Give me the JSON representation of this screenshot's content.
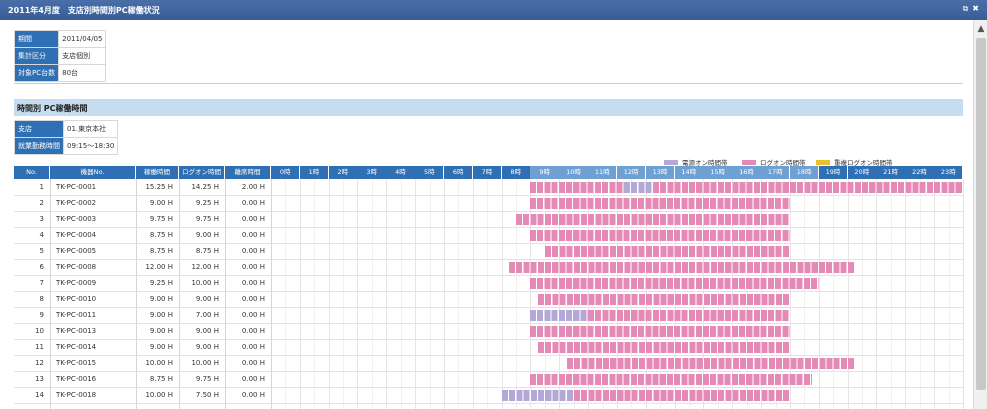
{
  "window": {
    "title": "2011年4月度　支店別時間別PC稼働状況",
    "controls": [
      "restore-icon",
      "close-icon"
    ]
  },
  "info": [
    {
      "label": "期間",
      "value": "2011/04/05"
    },
    {
      "label": "集計区分",
      "value": "支店個別"
    },
    {
      "label": "対象PC台数",
      "value": "80台"
    }
  ],
  "section_title": "時間別 PC稼働時間",
  "branch_info": [
    {
      "label": "支店",
      "value": "01.東京本社"
    },
    {
      "label": "就業勤務時間",
      "value": "09:15～18:30"
    }
  ],
  "legend": [
    {
      "label": "電源オン時間帯",
      "color": "#b3a8d6"
    },
    {
      "label": "ログオン時間帯",
      "color": "#e58ab7"
    },
    {
      "label": "重複ログオン時間帯",
      "color": "#e5c12a"
    }
  ],
  "columns": [
    "No.",
    "機器No.",
    "稼働時間",
    "ログオン時間",
    "離席時間"
  ],
  "hours": [
    "0時",
    "1時",
    "2時",
    "3時",
    "4時",
    "5時",
    "6時",
    "7時",
    "8時",
    "9時",
    "10時",
    "11時",
    "12時",
    "13時",
    "14時",
    "15時",
    "16時",
    "17時",
    "18時",
    "19時",
    "20時",
    "21時",
    "22時",
    "23時"
  ],
  "work_hours": [
    9,
    18
  ],
  "colors": {
    "power": "#b3a8d6",
    "logon": "#e58ab7",
    "dup": "#e5c12a",
    "header": "#2f6fb3",
    "header_hi": "#6ea0d4"
  },
  "rows": [
    {
      "no": "1",
      "pc": "TK-PC-0001",
      "op": "15.25 H",
      "logon": "14.25 H",
      "away": "2.00 H",
      "segs": [
        {
          "t": "logon",
          "s": 9,
          "e": 12.25
        },
        {
          "t": "power",
          "s": 12.25,
          "e": 13.25
        },
        {
          "t": "logon",
          "s": 13.25,
          "e": 24
        }
      ]
    },
    {
      "no": "2",
      "pc": "TK-PC-0002",
      "op": "9.00 H",
      "logon": "9.25 H",
      "away": "0.00 H",
      "segs": [
        {
          "t": "logon",
          "s": 9,
          "e": 18
        }
      ]
    },
    {
      "no": "3",
      "pc": "TK-PC-0003",
      "op": "9.75 H",
      "logon": "9.75 H",
      "away": "0.00 H",
      "segs": [
        {
          "t": "logon",
          "s": 8.5,
          "e": 18
        }
      ]
    },
    {
      "no": "4",
      "pc": "TK-PC-0004",
      "op": "8.75 H",
      "logon": "9.00 H",
      "away": "0.00 H",
      "segs": [
        {
          "t": "logon",
          "s": 9,
          "e": 18
        }
      ]
    },
    {
      "no": "5",
      "pc": "TK-PC-0005",
      "op": "8.75 H",
      "logon": "8.75 H",
      "away": "0.00 H",
      "segs": [
        {
          "t": "logon",
          "s": 9.5,
          "e": 18
        }
      ]
    },
    {
      "no": "6",
      "pc": "TK-PC-0008",
      "op": "12.00 H",
      "logon": "12.00 H",
      "away": "0.00 H",
      "segs": [
        {
          "t": "logon",
          "s": 8.25,
          "e": 20.25
        }
      ]
    },
    {
      "no": "7",
      "pc": "TK-PC-0009",
      "op": "9.25 H",
      "logon": "10.00 H",
      "away": "0.00 H",
      "segs": [
        {
          "t": "logon",
          "s": 9,
          "e": 19
        }
      ]
    },
    {
      "no": "8",
      "pc": "TK-PC-0010",
      "op": "9.00 H",
      "logon": "9.00 H",
      "away": "0.00 H",
      "segs": [
        {
          "t": "logon",
          "s": 9.25,
          "e": 18
        }
      ]
    },
    {
      "no": "9",
      "pc": "TK-PC-0011",
      "op": "9.00 H",
      "logon": "7.00 H",
      "away": "0.00 H",
      "segs": [
        {
          "t": "power",
          "s": 9,
          "e": 11
        },
        {
          "t": "logon",
          "s": 11,
          "e": 18
        }
      ]
    },
    {
      "no": "10",
      "pc": "TK-PC-0013",
      "op": "9.00 H",
      "logon": "9.00 H",
      "away": "0.00 H",
      "segs": [
        {
          "t": "logon",
          "s": 9,
          "e": 18
        }
      ]
    },
    {
      "no": "11",
      "pc": "TK-PC-0014",
      "op": "9.00 H",
      "logon": "9.00 H",
      "away": "0.00 H",
      "segs": [
        {
          "t": "logon",
          "s": 9.25,
          "e": 18
        }
      ]
    },
    {
      "no": "12",
      "pc": "TK-PC-0015",
      "op": "10.00 H",
      "logon": "10.00 H",
      "away": "0.00 H",
      "segs": [
        {
          "t": "logon",
          "s": 10.25,
          "e": 20.25
        }
      ]
    },
    {
      "no": "13",
      "pc": "TK-PC-0016",
      "op": "8.75 H",
      "logon": "9.75 H",
      "away": "0.00 H",
      "segs": [
        {
          "t": "logon",
          "s": 9,
          "e": 18.75
        }
      ]
    },
    {
      "no": "14",
      "pc": "TK-PC-0018",
      "op": "10.00 H",
      "logon": "7.50 H",
      "away": "0.00 H",
      "segs": [
        {
          "t": "power",
          "s": 8,
          "e": 10.5
        },
        {
          "t": "logon",
          "s": 10.5,
          "e": 18
        }
      ]
    }
  ]
}
